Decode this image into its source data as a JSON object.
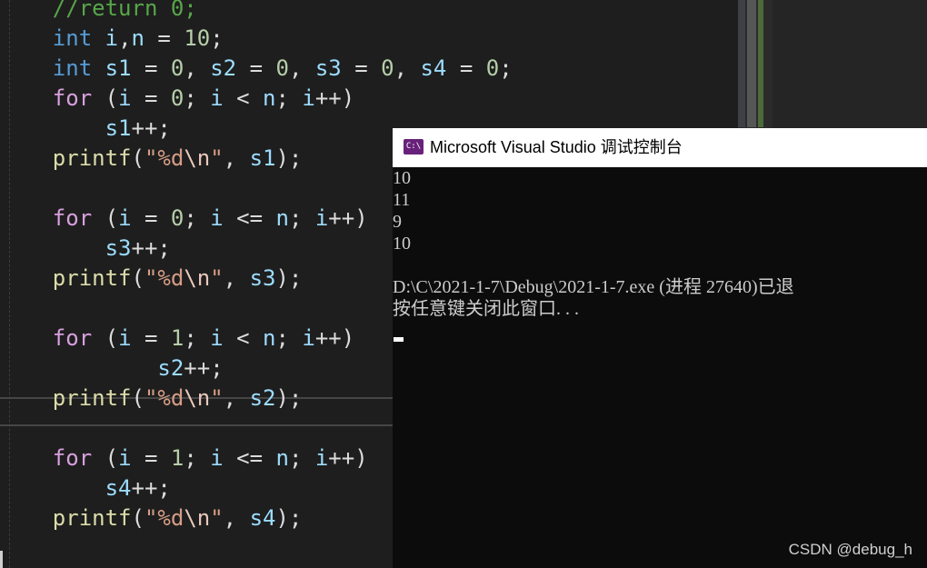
{
  "editor": {
    "lines": [
      {
        "parts": [
          {
            "t": "    ",
            "c": ""
          },
          {
            "t": "//return 0;",
            "c": "cmt"
          }
        ]
      },
      {
        "parts": [
          {
            "t": "    ",
            "c": ""
          },
          {
            "t": "int",
            "c": "kw"
          },
          {
            "t": " ",
            "c": ""
          },
          {
            "t": "i",
            "c": "id"
          },
          {
            "t": ",",
            "c": ""
          },
          {
            "t": "n",
            "c": "id"
          },
          {
            "t": " = ",
            "c": ""
          },
          {
            "t": "10",
            "c": "num"
          },
          {
            "t": ";",
            "c": ""
          }
        ]
      },
      {
        "parts": [
          {
            "t": "    ",
            "c": ""
          },
          {
            "t": "int",
            "c": "kw"
          },
          {
            "t": " ",
            "c": ""
          },
          {
            "t": "s1",
            "c": "id"
          },
          {
            "t": " = ",
            "c": ""
          },
          {
            "t": "0",
            "c": "num"
          },
          {
            "t": ", ",
            "c": ""
          },
          {
            "t": "s2",
            "c": "id"
          },
          {
            "t": " = ",
            "c": ""
          },
          {
            "t": "0",
            "c": "num"
          },
          {
            "t": ", ",
            "c": ""
          },
          {
            "t": "s3",
            "c": "id"
          },
          {
            "t": " = ",
            "c": ""
          },
          {
            "t": "0",
            "c": "num"
          },
          {
            "t": ", ",
            "c": ""
          },
          {
            "t": "s4",
            "c": "id"
          },
          {
            "t": " = ",
            "c": ""
          },
          {
            "t": "0",
            "c": "num"
          },
          {
            "t": ";",
            "c": ""
          }
        ]
      },
      {
        "parts": [
          {
            "t": "    ",
            "c": ""
          },
          {
            "t": "for",
            "c": "ctl"
          },
          {
            "t": " (",
            "c": ""
          },
          {
            "t": "i",
            "c": "id"
          },
          {
            "t": " = ",
            "c": ""
          },
          {
            "t": "0",
            "c": "num"
          },
          {
            "t": "; ",
            "c": ""
          },
          {
            "t": "i",
            "c": "id"
          },
          {
            "t": " < ",
            "c": ""
          },
          {
            "t": "n",
            "c": "id"
          },
          {
            "t": "; ",
            "c": ""
          },
          {
            "t": "i",
            "c": "id"
          },
          {
            "t": "++)",
            "c": ""
          }
        ]
      },
      {
        "parts": [
          {
            "t": "        ",
            "c": ""
          },
          {
            "t": "s1",
            "c": "id"
          },
          {
            "t": "++;",
            "c": ""
          }
        ]
      },
      {
        "parts": [
          {
            "t": "    ",
            "c": ""
          },
          {
            "t": "printf",
            "c": "fn"
          },
          {
            "t": "(",
            "c": ""
          },
          {
            "t": "\"%d",
            "c": "str"
          },
          {
            "t": "\\n",
            "c": "esc"
          },
          {
            "t": "\"",
            "c": "str"
          },
          {
            "t": ", ",
            "c": ""
          },
          {
            "t": "s1",
            "c": "id"
          },
          {
            "t": ");",
            "c": ""
          }
        ]
      },
      {
        "parts": []
      },
      {
        "parts": [
          {
            "t": "    ",
            "c": ""
          },
          {
            "t": "for",
            "c": "ctl"
          },
          {
            "t": " (",
            "c": ""
          },
          {
            "t": "i",
            "c": "id"
          },
          {
            "t": " = ",
            "c": ""
          },
          {
            "t": "0",
            "c": "num"
          },
          {
            "t": "; ",
            "c": ""
          },
          {
            "t": "i",
            "c": "id"
          },
          {
            "t": " <= ",
            "c": ""
          },
          {
            "t": "n",
            "c": "id"
          },
          {
            "t": "; ",
            "c": ""
          },
          {
            "t": "i",
            "c": "id"
          },
          {
            "t": "++)",
            "c": ""
          }
        ]
      },
      {
        "parts": [
          {
            "t": "        ",
            "c": ""
          },
          {
            "t": "s3",
            "c": "id"
          },
          {
            "t": "++;",
            "c": ""
          }
        ]
      },
      {
        "parts": [
          {
            "t": "    ",
            "c": ""
          },
          {
            "t": "printf",
            "c": "fn"
          },
          {
            "t": "(",
            "c": ""
          },
          {
            "t": "\"%d",
            "c": "str"
          },
          {
            "t": "\\n",
            "c": "esc"
          },
          {
            "t": "\"",
            "c": "str"
          },
          {
            "t": ", ",
            "c": ""
          },
          {
            "t": "s3",
            "c": "id"
          },
          {
            "t": ");",
            "c": ""
          }
        ]
      },
      {
        "parts": []
      },
      {
        "parts": [
          {
            "t": "    ",
            "c": ""
          },
          {
            "t": "for",
            "c": "ctl"
          },
          {
            "t": " (",
            "c": ""
          },
          {
            "t": "i",
            "c": "id"
          },
          {
            "t": " = ",
            "c": ""
          },
          {
            "t": "1",
            "c": "num"
          },
          {
            "t": "; ",
            "c": ""
          },
          {
            "t": "i",
            "c": "id"
          },
          {
            "t": " < ",
            "c": ""
          },
          {
            "t": "n",
            "c": "id"
          },
          {
            "t": "; ",
            "c": ""
          },
          {
            "t": "i",
            "c": "id"
          },
          {
            "t": "++)",
            "c": ""
          }
        ]
      },
      {
        "parts": [
          {
            "t": "            ",
            "c": ""
          },
          {
            "t": "s2",
            "c": "id"
          },
          {
            "t": "++;",
            "c": ""
          }
        ]
      },
      {
        "parts": [
          {
            "t": "    ",
            "c": ""
          },
          {
            "t": "printf",
            "c": "fn"
          },
          {
            "t": "(",
            "c": ""
          },
          {
            "t": "\"%d",
            "c": "str"
          },
          {
            "t": "\\n",
            "c": "esc"
          },
          {
            "t": "\"",
            "c": "str"
          },
          {
            "t": ", ",
            "c": ""
          },
          {
            "t": "s2",
            "c": "id"
          },
          {
            "t": ");",
            "c": ""
          }
        ]
      },
      {
        "parts": []
      },
      {
        "parts": [
          {
            "t": "    ",
            "c": ""
          },
          {
            "t": "for",
            "c": "ctl"
          },
          {
            "t": " (",
            "c": ""
          },
          {
            "t": "i",
            "c": "id"
          },
          {
            "t": " = ",
            "c": ""
          },
          {
            "t": "1",
            "c": "num"
          },
          {
            "t": "; ",
            "c": ""
          },
          {
            "t": "i",
            "c": "id"
          },
          {
            "t": " <= ",
            "c": ""
          },
          {
            "t": "n",
            "c": "id"
          },
          {
            "t": "; ",
            "c": ""
          },
          {
            "t": "i",
            "c": "id"
          },
          {
            "t": "++)",
            "c": ""
          }
        ]
      },
      {
        "parts": [
          {
            "t": "        ",
            "c": ""
          },
          {
            "t": "s4",
            "c": "id"
          },
          {
            "t": "++;",
            "c": ""
          }
        ]
      },
      {
        "parts": [
          {
            "t": "    ",
            "c": ""
          },
          {
            "t": "printf",
            "c": "fn"
          },
          {
            "t": "(",
            "c": ""
          },
          {
            "t": "\"%d",
            "c": "str"
          },
          {
            "t": "\\n",
            "c": "esc"
          },
          {
            "t": "\"",
            "c": "str"
          },
          {
            "t": ", ",
            "c": ""
          },
          {
            "t": "s4",
            "c": "id"
          },
          {
            "t": ");",
            "c": ""
          }
        ]
      }
    ]
  },
  "console": {
    "icon_text": "C:\\",
    "title": "Microsoft Visual Studio 调试控制台",
    "output": [
      "10",
      "11",
      "9",
      "10",
      "",
      "D:\\C\\2021-1-7\\Debug\\2021-1-7.exe (进程 27640)已退",
      "按任意键关闭此窗口. . ."
    ]
  },
  "watermark": "CSDN @debug_h",
  "colors": {
    "editor_bg": "#1e1e1e",
    "console_bg": "#0c0c0c",
    "keyword": "#569cd6",
    "control": "#d8a0df",
    "identifier": "#9cdcfe",
    "number": "#b5cea8",
    "string": "#d69d85",
    "function": "#dcdcaa"
  }
}
